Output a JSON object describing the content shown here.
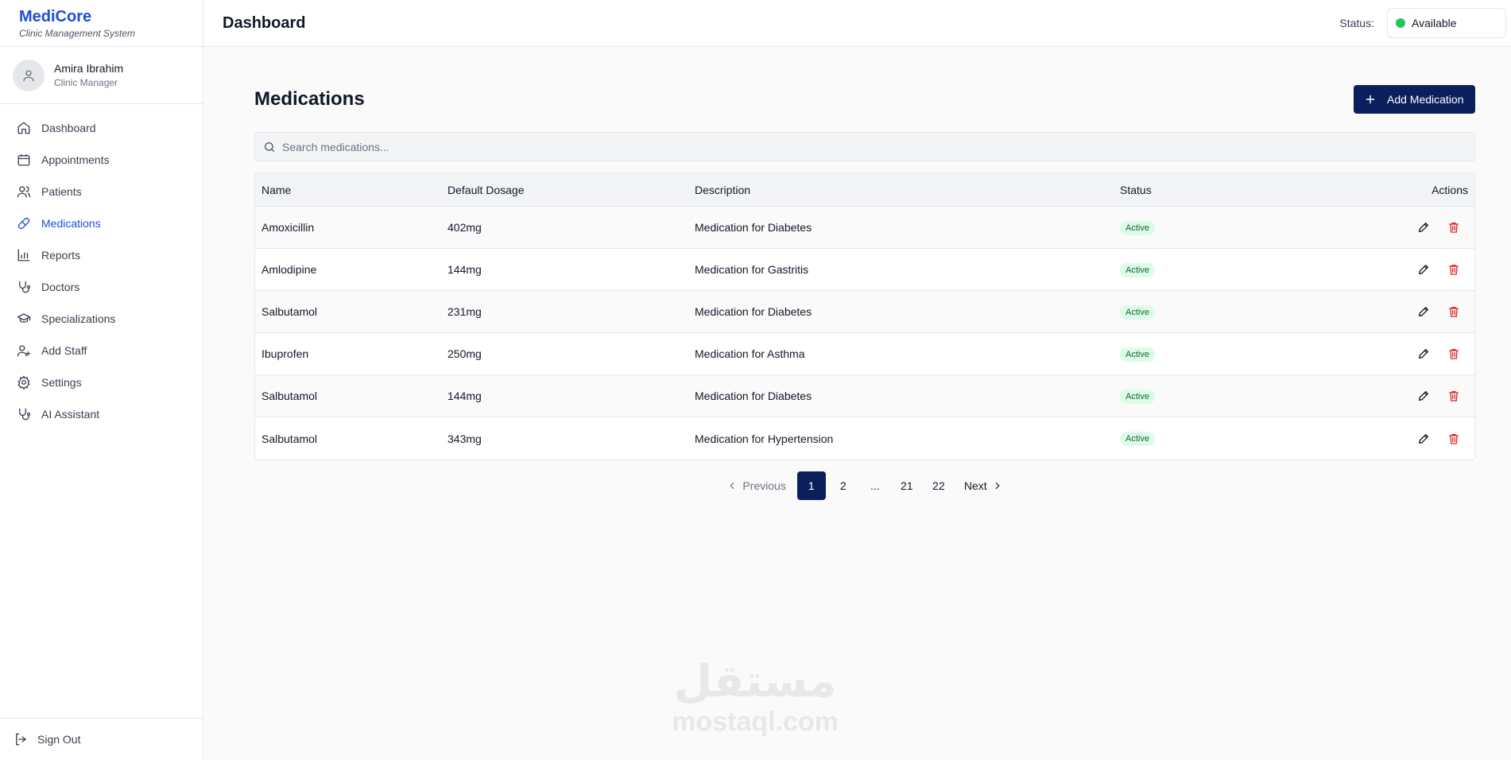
{
  "brand": {
    "name": "MediCore",
    "subtitle": "Clinic Management System"
  },
  "user": {
    "name": "Amira Ibrahim",
    "role": "Clinic Manager"
  },
  "nav": {
    "items": [
      {
        "label": "Dashboard",
        "icon": "home-icon"
      },
      {
        "label": "Appointments",
        "icon": "calendar-icon"
      },
      {
        "label": "Patients",
        "icon": "users-icon"
      },
      {
        "label": "Medications",
        "icon": "pill-icon",
        "active": true
      },
      {
        "label": "Reports",
        "icon": "bar-chart-icon"
      },
      {
        "label": "Doctors",
        "icon": "stethoscope-icon"
      },
      {
        "label": "Specializations",
        "icon": "graduation-cap-icon"
      },
      {
        "label": "Add Staff",
        "icon": "user-plus-icon"
      },
      {
        "label": "Settings",
        "icon": "gear-icon"
      },
      {
        "label": "AI Assistant",
        "icon": "stethoscope-icon"
      }
    ],
    "sign_out": "Sign Out"
  },
  "header": {
    "title": "Dashboard",
    "status_label": "Status:",
    "status_value": "Available",
    "status_color": "#22c55e"
  },
  "main": {
    "title": "Medications",
    "add_button": "Add Medication",
    "search_placeholder": "Search medications...",
    "columns": [
      "Name",
      "Default Dosage",
      "Description",
      "Status",
      "Actions"
    ],
    "rows": [
      {
        "name": "Amoxicillin",
        "dosage": "402mg",
        "description": "Medication for Diabetes",
        "status": "Active"
      },
      {
        "name": "Amlodipine",
        "dosage": "144mg",
        "description": "Medication for Gastritis",
        "status": "Active"
      },
      {
        "name": "Salbutamol",
        "dosage": "231mg",
        "description": "Medication for Diabetes",
        "status": "Active"
      },
      {
        "name": "Ibuprofen",
        "dosage": "250mg",
        "description": "Medication for Asthma",
        "status": "Active"
      },
      {
        "name": "Salbutamol",
        "dosage": "144mg",
        "description": "Medication for Diabetes",
        "status": "Active"
      },
      {
        "name": "Salbutamol",
        "dosage": "343mg",
        "description": "Medication for Hypertension",
        "status": "Active"
      }
    ],
    "pagination": {
      "previous": "Previous",
      "next": "Next",
      "pages": [
        "1",
        "2",
        "...",
        "21",
        "22"
      ],
      "current": "1"
    }
  },
  "watermark": {
    "arabic": "مستقل",
    "latin": "mostaql.com"
  },
  "colors": {
    "accent": "#1d4ed8",
    "primary_button": "#0b1f5c",
    "delete": "#dc2626",
    "active_badge_bg": "#dcfce7"
  }
}
